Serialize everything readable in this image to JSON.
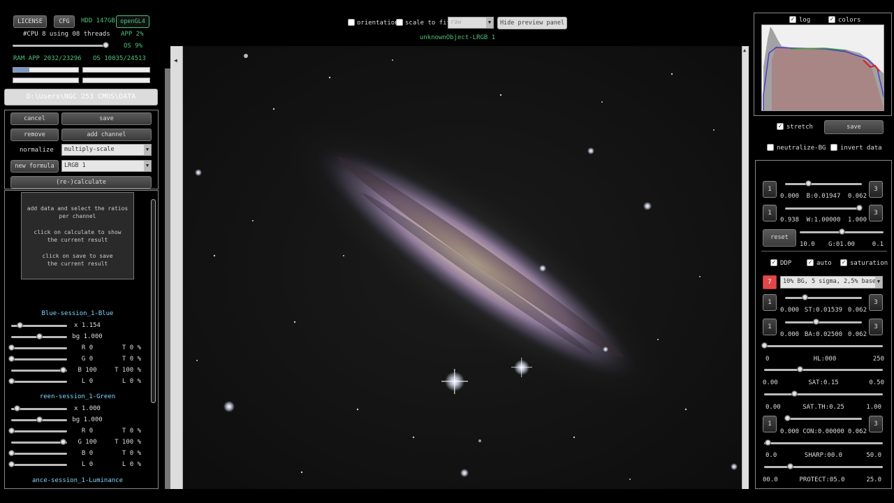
{
  "top": {
    "license": "LICENSE",
    "cfg": "CFG",
    "hdd": "HDD 147GB",
    "opengl": "openGL4",
    "cpu": "#CPU 8  using 08 threads",
    "app_cpu": "APP 2%",
    "os_cpu": "OS 9%",
    "ram": "RAM  APP 2032/23296",
    "os_ram": "OS 10035/24513",
    "path": "D:\\Users\\NGC 253 CMOS\\DATA"
  },
  "chan": {
    "cancel": "cancel",
    "save": "save",
    "remove": "remove",
    "add_channel": "add channel",
    "normalize": "normalize",
    "normalize_value": "multiply-scale",
    "new_formula": "new formula",
    "formula_value": "LRGB 1",
    "calculate": "(re-)calculate",
    "info1": "add data and select the ratios",
    "info2": "per channel",
    "info3": "click on calculate to show",
    "info4": "the current result",
    "info5": "click on save to save",
    "info6": "the current result"
  },
  "sessions": [
    {
      "title": "Blue-session_1-Blue",
      "rows": [
        {
          "l": "x 1.154",
          "r": ""
        },
        {
          "l": "bg 1.000",
          "r": ""
        },
        {
          "l": "R 0",
          "r": "T 0 %"
        },
        {
          "l": "G 0",
          "r": "T 0 %"
        },
        {
          "l": "B 100",
          "r": "T 100 %"
        },
        {
          "l": "L 0",
          "r": "L 0 %"
        }
      ]
    },
    {
      "title": "reen-session_1-Green",
      "rows": [
        {
          "l": "x 1.000",
          "r": ""
        },
        {
          "l": "bg 1.000",
          "r": ""
        },
        {
          "l": "R 0",
          "r": "T 0 %"
        },
        {
          "l": "G 100",
          "r": "T 100 %"
        },
        {
          "l": "B 0",
          "r": "T 0 %"
        },
        {
          "l": "L 0",
          "r": "L 0 %"
        }
      ]
    },
    {
      "title": "ance-session_1-Luminance",
      "rows": []
    }
  ],
  "preview": {
    "orientation": "orientation",
    "scale_to_fit": "scale to fit",
    "scale_value": "raw",
    "hide": "Hide preview panel",
    "object": "unknownObject-LRGB 1"
  },
  "right": {
    "log": "log",
    "colors": "colors",
    "stretch": "stretch",
    "save": "save",
    "neutralize": "neutralize-BG",
    "invert": "invert data",
    "b_min": "0.000",
    "b_label": "B:0.01947",
    "b_max": "0.062",
    "w_min": "0.938",
    "w_label": "W:1.00000",
    "w_max": "1.000",
    "reset": "reset",
    "g_min": "10.0",
    "g_label": "G:01.00",
    "g_max": "0.1",
    "ddp": "DDP",
    "auto": "auto",
    "saturation": "saturation",
    "preset_num": "7",
    "preset": "10% BG, 5 sigma, 2,5% base",
    "st_min": "0.000",
    "st_label": "ST:0.01539",
    "st_max": "0.062",
    "ba_min": "0.000",
    "ba_label": "BA:0.02500",
    "ba_max": "0.062",
    "hl_min": "0",
    "hl_label": "HL:000",
    "hl_max": "250",
    "sat_min": "0.00",
    "sat_label": "SAT:0.15",
    "sat_max": "0.50",
    "satth_min": "0.00",
    "satth_label": "SAT.TH:0.25",
    "satth_max": "1.00",
    "con_min": "0.000",
    "con_label": "CON:0.00000",
    "con_max": "0.062",
    "sharp_min": "0.0",
    "sharp_label": "SHARP:00.0",
    "sharp_max": "50.0",
    "prot_min": "00.0",
    "prot_label": "PROTECT:05.0",
    "prot_max": "25.0",
    "one": "1",
    "three": "3"
  }
}
